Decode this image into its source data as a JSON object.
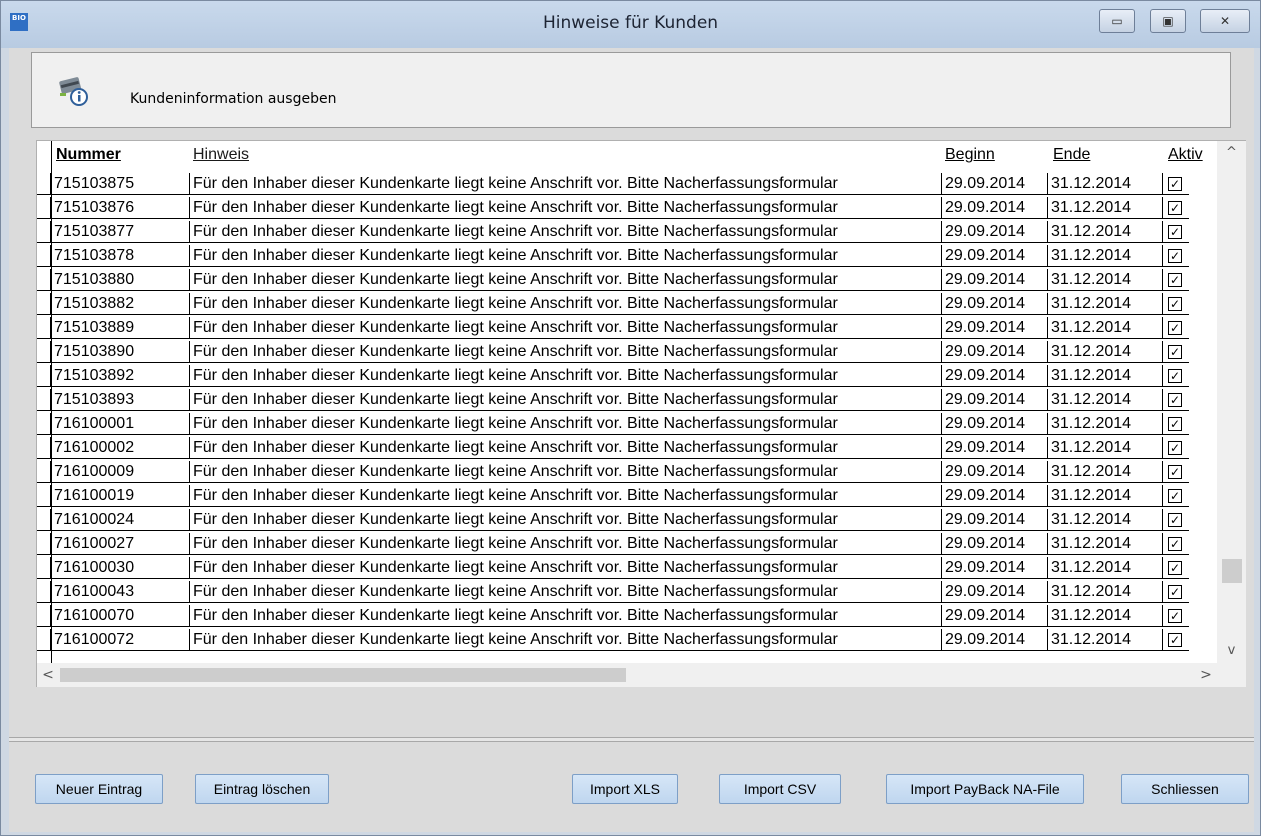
{
  "window": {
    "app_icon": "BIO",
    "title": "Hinweise für Kunden",
    "minimize": "▭",
    "maximize": "▣",
    "close": "✕"
  },
  "header": {
    "icon": "customer-card-info-icon",
    "text": "Kundeninformation ausgeben"
  },
  "table": {
    "columns": [
      "Nummer",
      "Hinweis",
      "Beginn",
      "Ende",
      "Aktiv"
    ],
    "rows": [
      {
        "nummer": "715103875",
        "hinweis": "Für den Inhaber dieser Kundenkarte liegt keine Anschrift vor. Bitte Nacherfassungsformular",
        "beginn": "29.09.2014",
        "ende": "31.12.2014",
        "aktiv": true
      },
      {
        "nummer": "715103876",
        "hinweis": "Für den Inhaber dieser Kundenkarte liegt keine Anschrift vor. Bitte Nacherfassungsformular",
        "beginn": "29.09.2014",
        "ende": "31.12.2014",
        "aktiv": true
      },
      {
        "nummer": "715103877",
        "hinweis": "Für den Inhaber dieser Kundenkarte liegt keine Anschrift vor. Bitte Nacherfassungsformular",
        "beginn": "29.09.2014",
        "ende": "31.12.2014",
        "aktiv": true
      },
      {
        "nummer": "715103878",
        "hinweis": "Für den Inhaber dieser Kundenkarte liegt keine Anschrift vor. Bitte Nacherfassungsformular",
        "beginn": "29.09.2014",
        "ende": "31.12.2014",
        "aktiv": true
      },
      {
        "nummer": "715103880",
        "hinweis": "Für den Inhaber dieser Kundenkarte liegt keine Anschrift vor. Bitte Nacherfassungsformular",
        "beginn": "29.09.2014",
        "ende": "31.12.2014",
        "aktiv": true
      },
      {
        "nummer": "715103882",
        "hinweis": "Für den Inhaber dieser Kundenkarte liegt keine Anschrift vor. Bitte Nacherfassungsformular",
        "beginn": "29.09.2014",
        "ende": "31.12.2014",
        "aktiv": true
      },
      {
        "nummer": "715103889",
        "hinweis": "Für den Inhaber dieser Kundenkarte liegt keine Anschrift vor. Bitte Nacherfassungsformular",
        "beginn": "29.09.2014",
        "ende": "31.12.2014",
        "aktiv": true
      },
      {
        "nummer": "715103890",
        "hinweis": "Für den Inhaber dieser Kundenkarte liegt keine Anschrift vor. Bitte Nacherfassungsformular",
        "beginn": "29.09.2014",
        "ende": "31.12.2014",
        "aktiv": true
      },
      {
        "nummer": "715103892",
        "hinweis": "Für den Inhaber dieser Kundenkarte liegt keine Anschrift vor. Bitte Nacherfassungsformular",
        "beginn": "29.09.2014",
        "ende": "31.12.2014",
        "aktiv": true
      },
      {
        "nummer": "715103893",
        "hinweis": "Für den Inhaber dieser Kundenkarte liegt keine Anschrift vor. Bitte Nacherfassungsformular",
        "beginn": "29.09.2014",
        "ende": "31.12.2014",
        "aktiv": true
      },
      {
        "nummer": "716100001",
        "hinweis": "Für den Inhaber dieser Kundenkarte liegt keine Anschrift vor. Bitte Nacherfassungsformular",
        "beginn": "29.09.2014",
        "ende": "31.12.2014",
        "aktiv": true
      },
      {
        "nummer": "716100002",
        "hinweis": "Für den Inhaber dieser Kundenkarte liegt keine Anschrift vor. Bitte Nacherfassungsformular",
        "beginn": "29.09.2014",
        "ende": "31.12.2014",
        "aktiv": true
      },
      {
        "nummer": "716100009",
        "hinweis": "Für den Inhaber dieser Kundenkarte liegt keine Anschrift vor. Bitte Nacherfassungsformular",
        "beginn": "29.09.2014",
        "ende": "31.12.2014",
        "aktiv": true
      },
      {
        "nummer": "716100019",
        "hinweis": "Für den Inhaber dieser Kundenkarte liegt keine Anschrift vor. Bitte Nacherfassungsformular",
        "beginn": "29.09.2014",
        "ende": "31.12.2014",
        "aktiv": true
      },
      {
        "nummer": "716100024",
        "hinweis": "Für den Inhaber dieser Kundenkarte liegt keine Anschrift vor. Bitte Nacherfassungsformular",
        "beginn": "29.09.2014",
        "ende": "31.12.2014",
        "aktiv": true
      },
      {
        "nummer": "716100027",
        "hinweis": "Für den Inhaber dieser Kundenkarte liegt keine Anschrift vor. Bitte Nacherfassungsformular",
        "beginn": "29.09.2014",
        "ende": "31.12.2014",
        "aktiv": true
      },
      {
        "nummer": "716100030",
        "hinweis": "Für den Inhaber dieser Kundenkarte liegt keine Anschrift vor. Bitte Nacherfassungsformular",
        "beginn": "29.09.2014",
        "ende": "31.12.2014",
        "aktiv": true
      },
      {
        "nummer": "716100043",
        "hinweis": "Für den Inhaber dieser Kundenkarte liegt keine Anschrift vor. Bitte Nacherfassungsformular",
        "beginn": "29.09.2014",
        "ende": "31.12.2014",
        "aktiv": true
      },
      {
        "nummer": "716100070",
        "hinweis": "Für den Inhaber dieser Kundenkarte liegt keine Anschrift vor. Bitte Nacherfassungsformular",
        "beginn": "29.09.2014",
        "ende": "31.12.2014",
        "aktiv": true
      },
      {
        "nummer": "716100072",
        "hinweis": "Für den Inhaber dieser Kundenkarte liegt keine Anschrift vor. Bitte Nacherfassungsformular",
        "beginn": "29.09.2014",
        "ende": "31.12.2014",
        "aktiv": true
      }
    ],
    "scroll_up": "^",
    "scroll_down": "v",
    "scroll_left": "<",
    "scroll_right": ">"
  },
  "buttons": {
    "new_entry": "Neuer Eintrag",
    "delete_entry": "Eintrag löschen",
    "import_xls": "Import XLS",
    "import_csv": "Import CSV",
    "import_payback": "Import PayBack NA-File",
    "close": "Schliessen"
  },
  "colors": {
    "button_bg": "#c7dcf2",
    "checkbox_mark": "#000000"
  }
}
